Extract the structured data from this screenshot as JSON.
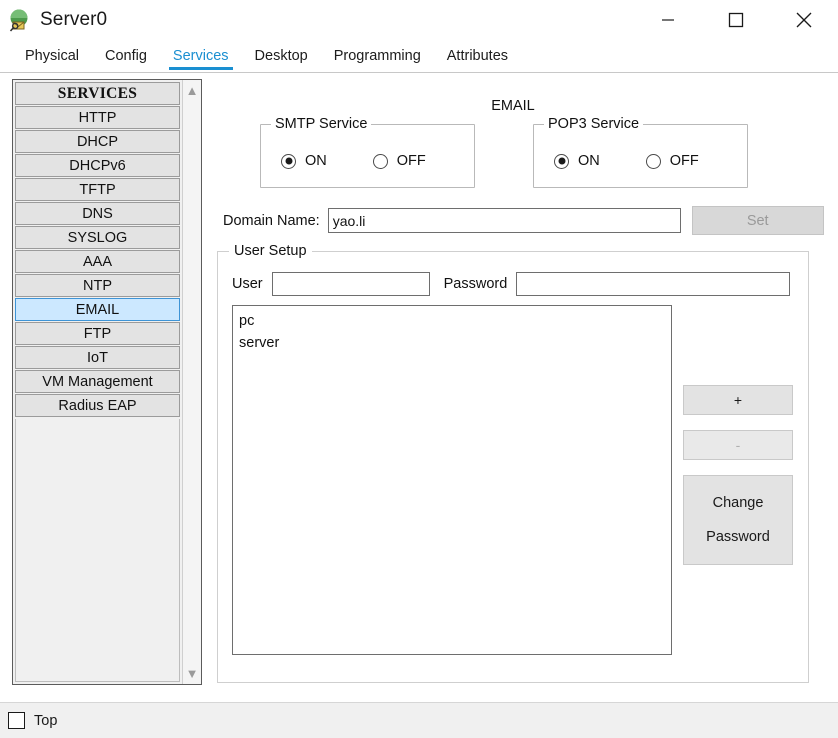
{
  "window": {
    "title": "Server0",
    "icon": "server-mail-icon",
    "controls": {
      "minimize": "minimize-icon",
      "maximize": "maximize-icon",
      "close": "close-icon"
    }
  },
  "tabs": [
    {
      "label": "Physical",
      "active": false
    },
    {
      "label": "Config",
      "active": false
    },
    {
      "label": "Services",
      "active": true
    },
    {
      "label": "Desktop",
      "active": false
    },
    {
      "label": "Programming",
      "active": false
    },
    {
      "label": "Attributes",
      "active": false
    }
  ],
  "sidebar": {
    "header": "SERVICES",
    "selected": "EMAIL",
    "items": [
      {
        "label": "HTTP"
      },
      {
        "label": "DHCP"
      },
      {
        "label": "DHCPv6"
      },
      {
        "label": "TFTP"
      },
      {
        "label": "DNS"
      },
      {
        "label": "SYSLOG"
      },
      {
        "label": "AAA"
      },
      {
        "label": "NTP"
      },
      {
        "label": "EMAIL"
      },
      {
        "label": "FTP"
      },
      {
        "label": "IoT"
      },
      {
        "label": "VM Management"
      },
      {
        "label": "Radius EAP"
      }
    ],
    "scroll_up": "chevron-up-icon",
    "scroll_down": "chevron-down-icon"
  },
  "main": {
    "panel_title": "EMAIL",
    "smtp": {
      "legend": "SMTP Service",
      "on_label": "ON",
      "off_label": "OFF",
      "value": "ON"
    },
    "pop3": {
      "legend": "POP3 Service",
      "on_label": "ON",
      "off_label": "OFF",
      "value": "ON"
    },
    "domain": {
      "label": "Domain Name:",
      "value": "yao.li",
      "set_button": "Set",
      "set_enabled": false
    },
    "user_setup": {
      "legend": "User Setup",
      "user_label": "User",
      "user_value": "",
      "password_label": "Password",
      "password_value": "",
      "users": [
        "pc",
        "server"
      ],
      "add_button": "+",
      "remove_button": "-",
      "change_line1": "Change",
      "change_line2": "Password"
    }
  },
  "statusbar": {
    "top_checkbox_label": "Top",
    "top_checked": false
  },
  "colors": {
    "accent": "#1a8fd1",
    "selection": "#cce8ff",
    "selection_border": "#3e94d6",
    "button_face": "#e3e3e3",
    "panel": "#f0f0f0"
  }
}
